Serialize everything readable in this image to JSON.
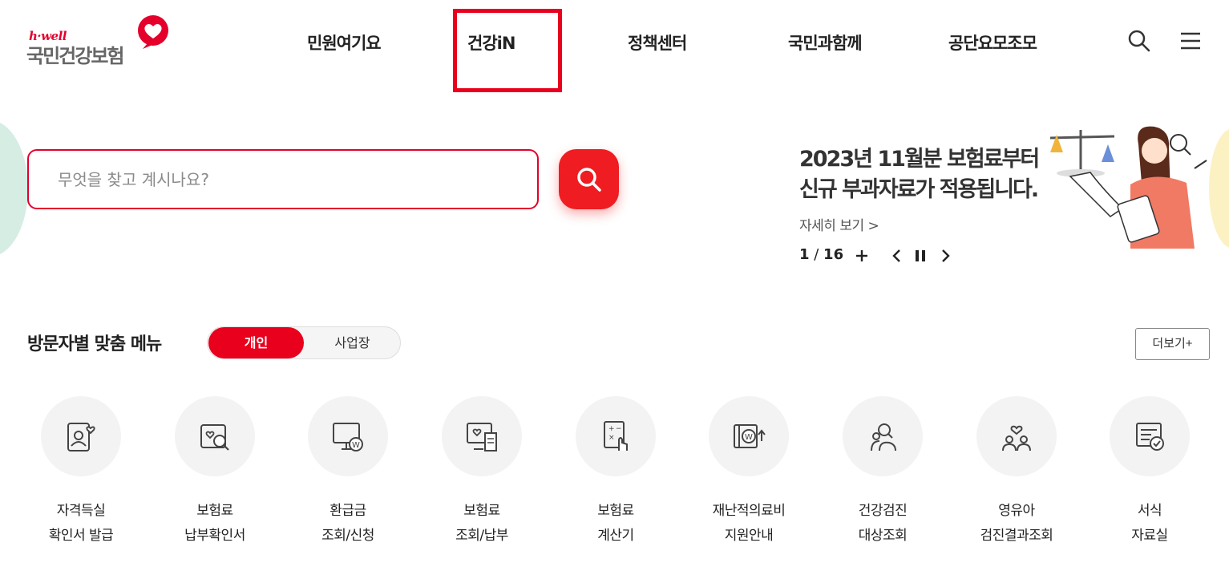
{
  "header": {
    "logo_small": "h·well",
    "logo_main": "국민건강보험",
    "nav": [
      "민원여기요",
      "건강iN",
      "정책센터",
      "국민과함께",
      "공단요모조모"
    ],
    "search_icon": "search-icon",
    "menu_icon": "hamburger-menu-icon"
  },
  "search": {
    "placeholder": "무엇을 찾고 계시나요?",
    "button_icon": "search-icon"
  },
  "banner": {
    "title_line1": "2023년 11월분 보험료부터",
    "title_line2": "신규 부과자료가 적용됩니다.",
    "link": "자세히 보기 >",
    "current": "1",
    "total": "16",
    "counter_sep": " / "
  },
  "visitor_menu": {
    "title": "방문자별 맞춤 메뉴",
    "tabs": [
      "개인",
      "사업장"
    ],
    "active_tab": "개인",
    "more": "더보기+"
  },
  "quick_menus": [
    {
      "line1": "자격득실",
      "line2": "확인서 발급",
      "icon": "id-card-heart-icon"
    },
    {
      "line1": "보험료",
      "line2": "납부확인서",
      "icon": "document-search-icon"
    },
    {
      "line1": "환급금",
      "line2": "조회/신청",
      "icon": "monitor-won-icon"
    },
    {
      "line1": "보험료",
      "line2": "조회/납부",
      "icon": "monitor-receipt-icon"
    },
    {
      "line1": "보험료",
      "line2": "계산기",
      "icon": "calculator-icon"
    },
    {
      "line1": "재난적의료비",
      "line2": "지원안내",
      "icon": "wallet-won-icon"
    },
    {
      "line1": "건강검진",
      "line2": "대상조회",
      "icon": "people-search-icon"
    },
    {
      "line1": "영유아",
      "line2": "검진결과조회",
      "icon": "family-heart-icon"
    },
    {
      "line1": "서식",
      "line2": "자료실",
      "icon": "form-check-icon"
    }
  ],
  "colors": {
    "brand_red": "#e8001c",
    "search_button": "#ef1c21",
    "text": "#222222"
  }
}
